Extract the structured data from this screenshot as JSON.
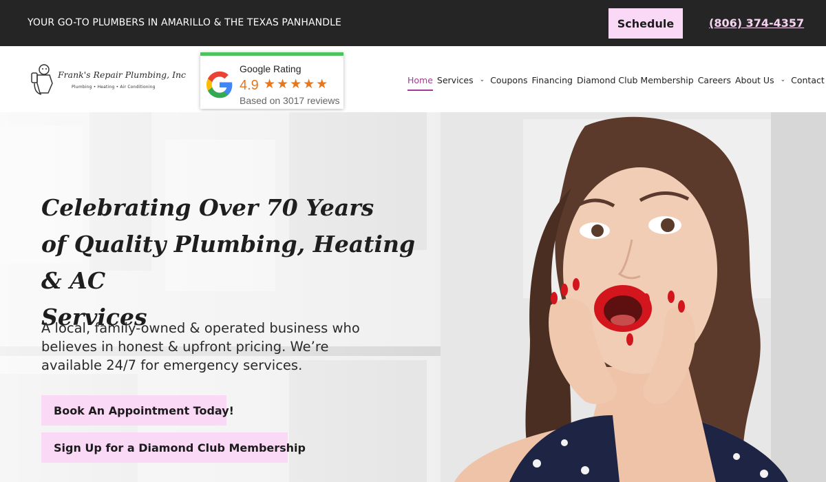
{
  "topbar": {
    "tagline": "YOUR GO-TO PLUMBERS IN AMARILLO & THE TEXAS PANHANDLE",
    "schedule_label": "Schedule",
    "phone": "(806) 374-4357"
  },
  "logo": {
    "name": "Frank's Repair Plumbing, Inc",
    "services": "Plumbing  •  Heating  •  Air Conditioning"
  },
  "google_rating": {
    "title": "Google Rating",
    "score": "4.9",
    "stars": "★★★★★",
    "reviews": "Based on 3017 reviews"
  },
  "nav": {
    "items": [
      {
        "label": "Home",
        "active": true
      },
      {
        "label": "Services",
        "dropdown": true
      },
      {
        "label": "Coupons"
      },
      {
        "label": "Financing"
      },
      {
        "label": "Diamond Club Membership"
      },
      {
        "label": "Careers"
      },
      {
        "label": "About Us",
        "dropdown": true
      },
      {
        "label": "Contact Us"
      }
    ]
  },
  "hero": {
    "headline_line1": "Celebrating Over 70 Years",
    "headline_line2": "of Quality Plumbing, Heating & AC",
    "headline_line3": "Services",
    "description": "A local, family-owned & operated business who believes in honest & upfront pricing. We’re available 24/7 for emergency services.",
    "cta_book": "Book An Appointment Today!",
    "cta_diamond": "Sign Up for a Diamond Club Membership"
  },
  "colors": {
    "topbar_bg": "#252525",
    "button_pink": "#f9d9f6",
    "nav_active": "#a03a94",
    "rating_orange": "#e5771e",
    "google_green": "#4cc35d"
  },
  "icons": {
    "chevron": "chevron-down-icon",
    "star": "star-icon",
    "google": "google-g-icon"
  }
}
